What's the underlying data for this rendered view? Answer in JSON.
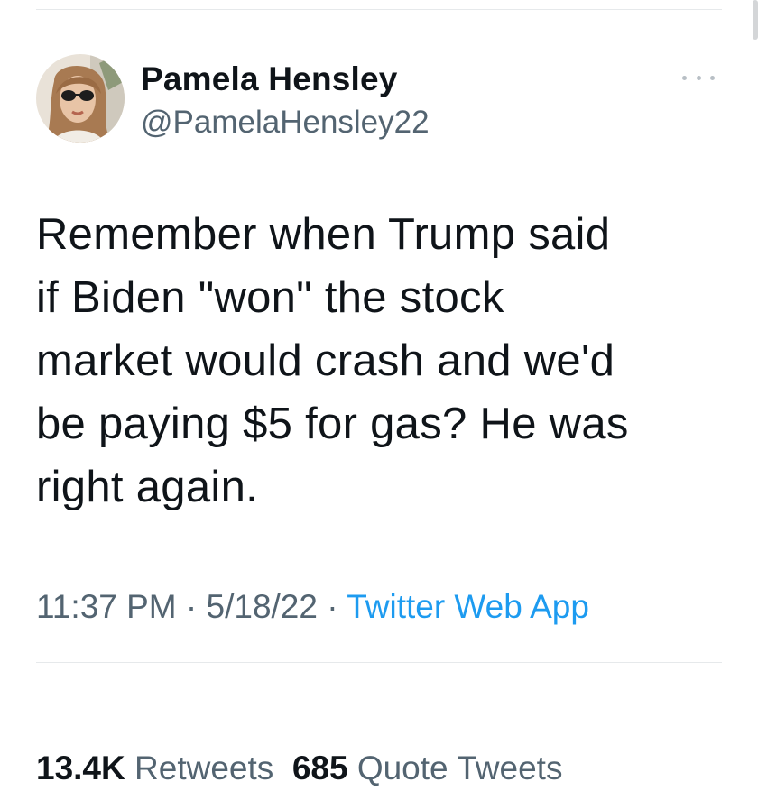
{
  "tweet": {
    "author": {
      "display_name": "Pamela Hensley",
      "handle": "@PamelaHensley22"
    },
    "text": "Remember when Trump said\nif Biden \"won\" the stock\nmarket would crash and we'd\nbe paying $5 for gas? He was\nright again.",
    "time": "11:37 PM",
    "separator": " · ",
    "date": "5/18/22",
    "source": "Twitter Web App",
    "stats": {
      "retweets_count": "13.4K",
      "retweets_label": "Retweets",
      "quotes_count": "685",
      "quotes_label": "Quote Tweets"
    }
  },
  "icons": {
    "more": "more-horizontal-icon"
  },
  "colors": {
    "text_primary": "#0f1419",
    "text_secondary": "#536471",
    "link": "#1d9bf0",
    "divider": "#e6e9eb"
  }
}
